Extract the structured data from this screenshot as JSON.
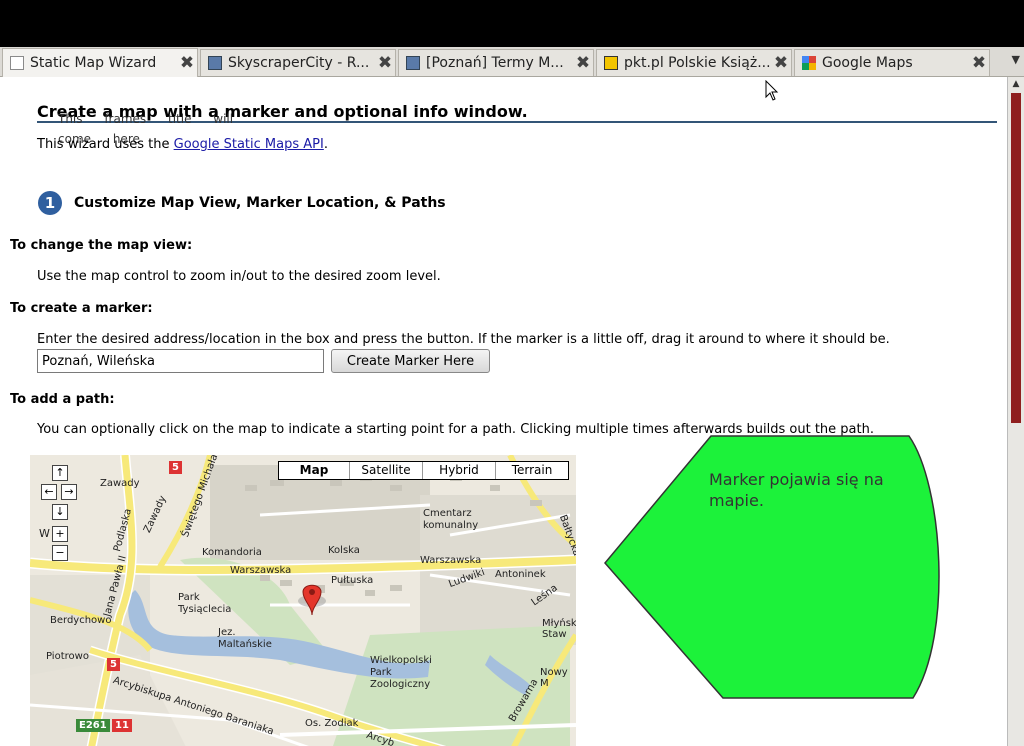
{
  "tabs": [
    {
      "title": "Static Map Wizard",
      "active": true
    },
    {
      "title": "SkyscraperCity - R...",
      "active": false
    },
    {
      "title": "[Poznań] Termy M...",
      "active": false
    },
    {
      "title": "pkt.pl Polskie Książ...",
      "active": false
    },
    {
      "title": "Google Maps",
      "active": false
    }
  ],
  "page": {
    "title": "Create a map with a marker and optional info window.",
    "overlay_text": "This frames title will come here",
    "intro_prefix": "This wizard uses the ",
    "intro_link": "Google Static Maps API",
    "intro_suffix": ".",
    "step_number": "1",
    "step_title": "Customize Map View, Marker Location, & Paths",
    "view_heading": "To change the map view:",
    "view_text": "Use the map control to zoom in/out to the desired zoom level.",
    "marker_heading": "To create a marker:",
    "marker_text": "Enter the desired address/location in the box and press the button. If the marker is a little off, drag it around to where it should be.",
    "address_value": "Poznań, Wileńska",
    "create_button": "Create Marker Here",
    "path_heading": "To add a path:",
    "path_text": "You can optionally click on the map to indicate a starting point for a path. Clicking multiple times afterwards builds out the path."
  },
  "map": {
    "types": [
      "Map",
      "Satellite",
      "Hybrid",
      "Terrain"
    ],
    "selected_type": "Map",
    "controls": {
      "up": "↑",
      "left": "←",
      "right": "→",
      "down": "↓",
      "zoom_in": "+",
      "zoom_out": "−",
      "w": "W"
    },
    "labels": {
      "zawady": "Zawady",
      "cmentarz": "Cmentarz komunalny",
      "komandoria": "Komandoria",
      "kolska": "Kolska",
      "warszawska1": "Warszawska",
      "warszawska2": "Warszawska",
      "pultuska": "Pułtuska",
      "antoninek": "Antoninek",
      "park_tysiaclecia": "Park Tysiąclecia",
      "berdychowo": "Berdychowo",
      "jez_maltanskie": "Jez. Maltańskie",
      "piotrowo": "Piotrowo",
      "arcybiskupa": "Arcybiskupa Antoniego Baraniaka",
      "wielkopolski": "Wielkopolski Park Zoologiczny",
      "os_zodiak": "Os. Zodiak",
      "nowy_m": "Nowy M",
      "mylnski": "Młyński Staw",
      "lesna": "Leśna",
      "browarna": "Browarna",
      "bałtycka": "Bałtycka",
      "jana_pawla": "Jana Pawła II",
      "podlaska": "Podlaska",
      "zawady_st": "Zawady",
      "swietego_michala": "Świętego Michała",
      "lumily": "Ludwiki",
      "arcybiskupa2": "Arcyb"
    },
    "shields": {
      "s5a": "5",
      "s5b": "5",
      "e261": "E261",
      "s11": "11"
    }
  },
  "callout": {
    "text": "Marker pojawia się na mapie.",
    "color": "#1cf23a"
  },
  "colors": {
    "heading_rule": "#335577",
    "link": "#1a1aa6",
    "step_circle": "#2f5f9f"
  }
}
